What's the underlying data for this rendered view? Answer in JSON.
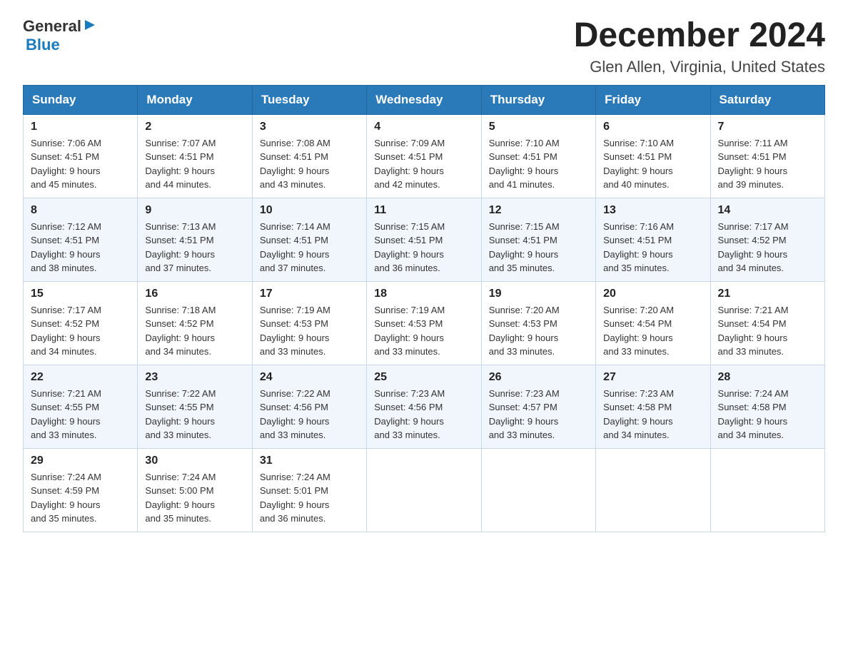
{
  "header": {
    "title": "December 2024",
    "subtitle": "Glen Allen, Virginia, United States"
  },
  "logo": {
    "line1": "General",
    "line2": "Blue"
  },
  "days_of_week": [
    "Sunday",
    "Monday",
    "Tuesday",
    "Wednesday",
    "Thursday",
    "Friday",
    "Saturday"
  ],
  "weeks": [
    [
      {
        "day": "1",
        "sunrise": "7:06 AM",
        "sunset": "4:51 PM",
        "daylight": "9 hours and 45 minutes."
      },
      {
        "day": "2",
        "sunrise": "7:07 AM",
        "sunset": "4:51 PM",
        "daylight": "9 hours and 44 minutes."
      },
      {
        "day": "3",
        "sunrise": "7:08 AM",
        "sunset": "4:51 PM",
        "daylight": "9 hours and 43 minutes."
      },
      {
        "day": "4",
        "sunrise": "7:09 AM",
        "sunset": "4:51 PM",
        "daylight": "9 hours and 42 minutes."
      },
      {
        "day": "5",
        "sunrise": "7:10 AM",
        "sunset": "4:51 PM",
        "daylight": "9 hours and 41 minutes."
      },
      {
        "day": "6",
        "sunrise": "7:10 AM",
        "sunset": "4:51 PM",
        "daylight": "9 hours and 40 minutes."
      },
      {
        "day": "7",
        "sunrise": "7:11 AM",
        "sunset": "4:51 PM",
        "daylight": "9 hours and 39 minutes."
      }
    ],
    [
      {
        "day": "8",
        "sunrise": "7:12 AM",
        "sunset": "4:51 PM",
        "daylight": "9 hours and 38 minutes."
      },
      {
        "day": "9",
        "sunrise": "7:13 AM",
        "sunset": "4:51 PM",
        "daylight": "9 hours and 37 minutes."
      },
      {
        "day": "10",
        "sunrise": "7:14 AM",
        "sunset": "4:51 PM",
        "daylight": "9 hours and 37 minutes."
      },
      {
        "day": "11",
        "sunrise": "7:15 AM",
        "sunset": "4:51 PM",
        "daylight": "9 hours and 36 minutes."
      },
      {
        "day": "12",
        "sunrise": "7:15 AM",
        "sunset": "4:51 PM",
        "daylight": "9 hours and 35 minutes."
      },
      {
        "day": "13",
        "sunrise": "7:16 AM",
        "sunset": "4:51 PM",
        "daylight": "9 hours and 35 minutes."
      },
      {
        "day": "14",
        "sunrise": "7:17 AM",
        "sunset": "4:52 PM",
        "daylight": "9 hours and 34 minutes."
      }
    ],
    [
      {
        "day": "15",
        "sunrise": "7:17 AM",
        "sunset": "4:52 PM",
        "daylight": "9 hours and 34 minutes."
      },
      {
        "day": "16",
        "sunrise": "7:18 AM",
        "sunset": "4:52 PM",
        "daylight": "9 hours and 34 minutes."
      },
      {
        "day": "17",
        "sunrise": "7:19 AM",
        "sunset": "4:53 PM",
        "daylight": "9 hours and 33 minutes."
      },
      {
        "day": "18",
        "sunrise": "7:19 AM",
        "sunset": "4:53 PM",
        "daylight": "9 hours and 33 minutes."
      },
      {
        "day": "19",
        "sunrise": "7:20 AM",
        "sunset": "4:53 PM",
        "daylight": "9 hours and 33 minutes."
      },
      {
        "day": "20",
        "sunrise": "7:20 AM",
        "sunset": "4:54 PM",
        "daylight": "9 hours and 33 minutes."
      },
      {
        "day": "21",
        "sunrise": "7:21 AM",
        "sunset": "4:54 PM",
        "daylight": "9 hours and 33 minutes."
      }
    ],
    [
      {
        "day": "22",
        "sunrise": "7:21 AM",
        "sunset": "4:55 PM",
        "daylight": "9 hours and 33 minutes."
      },
      {
        "day": "23",
        "sunrise": "7:22 AM",
        "sunset": "4:55 PM",
        "daylight": "9 hours and 33 minutes."
      },
      {
        "day": "24",
        "sunrise": "7:22 AM",
        "sunset": "4:56 PM",
        "daylight": "9 hours and 33 minutes."
      },
      {
        "day": "25",
        "sunrise": "7:23 AM",
        "sunset": "4:56 PM",
        "daylight": "9 hours and 33 minutes."
      },
      {
        "day": "26",
        "sunrise": "7:23 AM",
        "sunset": "4:57 PM",
        "daylight": "9 hours and 33 minutes."
      },
      {
        "day": "27",
        "sunrise": "7:23 AM",
        "sunset": "4:58 PM",
        "daylight": "9 hours and 34 minutes."
      },
      {
        "day": "28",
        "sunrise": "7:24 AM",
        "sunset": "4:58 PM",
        "daylight": "9 hours and 34 minutes."
      }
    ],
    [
      {
        "day": "29",
        "sunrise": "7:24 AM",
        "sunset": "4:59 PM",
        "daylight": "9 hours and 35 minutes."
      },
      {
        "day": "30",
        "sunrise": "7:24 AM",
        "sunset": "5:00 PM",
        "daylight": "9 hours and 35 minutes."
      },
      {
        "day": "31",
        "sunrise": "7:24 AM",
        "sunset": "5:01 PM",
        "daylight": "9 hours and 36 minutes."
      },
      null,
      null,
      null,
      null
    ]
  ],
  "labels": {
    "sunrise": "Sunrise:",
    "sunset": "Sunset:",
    "daylight": "Daylight:"
  }
}
